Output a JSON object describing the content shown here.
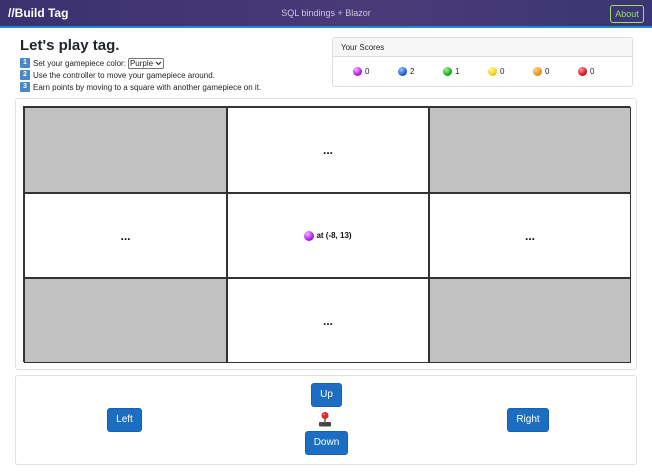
{
  "header": {
    "brand": "//Build Tag",
    "center_text": "SQL bindings + Blazor",
    "about_label": "About"
  },
  "intro": {
    "title": "Let's play tag.",
    "steps": [
      {
        "num": "1",
        "text": "Set your gamepiece color:"
      },
      {
        "num": "2",
        "text": "Use the controller to move your gamepiece around."
      },
      {
        "num": "3",
        "text": "Earn points by moving to a square with another gamepiece on it."
      }
    ],
    "color_select": {
      "value": "Purple"
    }
  },
  "scores": {
    "title": "Your Scores",
    "items": [
      {
        "color_name": "purple",
        "color": "#b31cf0",
        "value": "0"
      },
      {
        "color_name": "blue",
        "color": "#1f5fd6",
        "value": "2"
      },
      {
        "color_name": "green",
        "color": "#16b11a",
        "value": "1"
      },
      {
        "color_name": "yellow",
        "color": "#f2d70f",
        "value": "0"
      },
      {
        "color_name": "orange",
        "color": "#f09512",
        "value": "0"
      },
      {
        "color_name": "red",
        "color": "#e0141a",
        "value": "0"
      }
    ]
  },
  "board": {
    "cells": [
      {
        "type": "blocked",
        "text": ""
      },
      {
        "type": "empty",
        "text": "..."
      },
      {
        "type": "blocked",
        "text": ""
      },
      {
        "type": "empty",
        "text": "..."
      },
      {
        "type": "player",
        "text": "at (-8, 13)",
        "color": "#b31cf0"
      },
      {
        "type": "empty",
        "text": "..."
      },
      {
        "type": "blocked",
        "text": ""
      },
      {
        "type": "empty",
        "text": "..."
      },
      {
        "type": "blocked",
        "text": ""
      }
    ]
  },
  "controller": {
    "up_label": "Up",
    "down_label": "Down",
    "left_label": "Left",
    "right_label": "Right",
    "center_icon": "joystick-icon"
  }
}
